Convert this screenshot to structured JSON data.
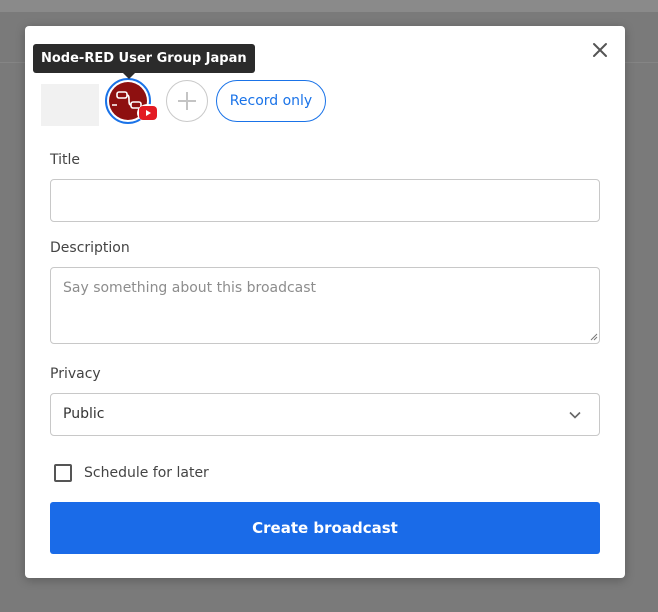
{
  "tooltip": {
    "text": "Node-RED User Group Japan"
  },
  "destinations": {
    "avatar_icon": "node-red-logo",
    "badge_icon": "youtube-icon",
    "add_icon": "plus-icon",
    "record_only_label": "Record only"
  },
  "form": {
    "title": {
      "label": "Title",
      "value": "",
      "placeholder": ""
    },
    "description": {
      "label": "Description",
      "value": "",
      "placeholder": "Say something about this broadcast"
    },
    "privacy": {
      "label": "Privacy",
      "selected": "Public"
    },
    "schedule": {
      "label": "Schedule for later",
      "checked": false
    },
    "submit_label": "Create broadcast"
  },
  "colors": {
    "accent": "#1a6be8",
    "avatar_bg": "#8e1010",
    "youtube_red": "#e31b23"
  }
}
